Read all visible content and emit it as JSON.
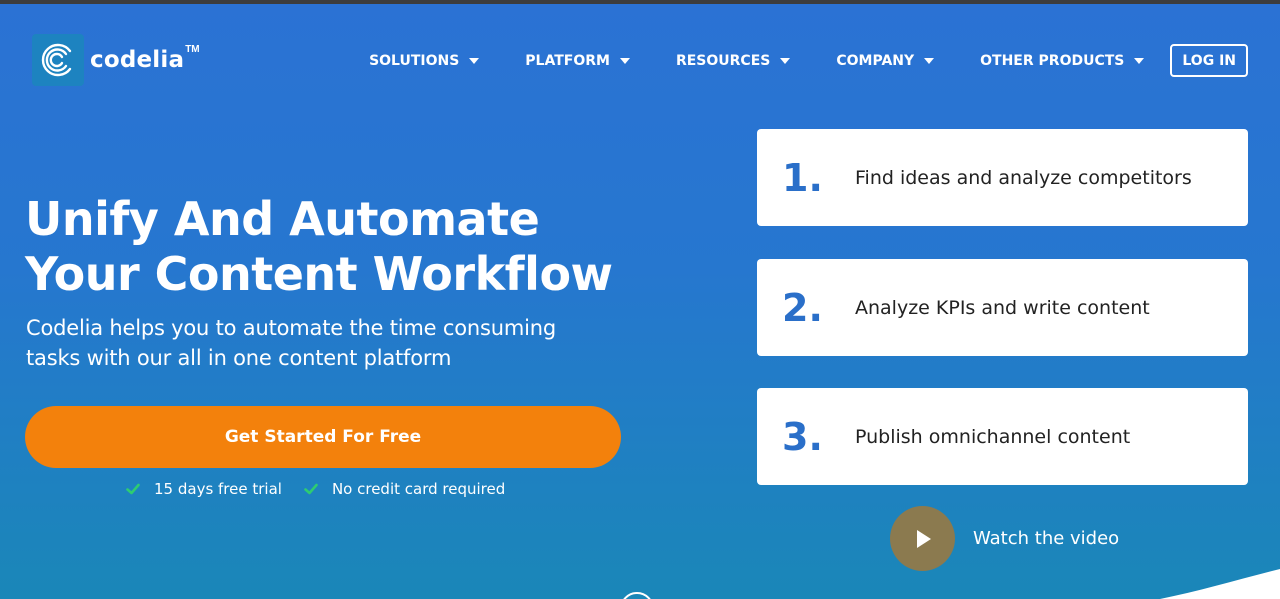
{
  "brand": {
    "name": "codelia",
    "trademark": "TM",
    "logo_icon": "concentric-c-logo-icon"
  },
  "nav": {
    "items": [
      {
        "label": "SOLUTIONS",
        "icon": "caret-down-icon"
      },
      {
        "label": "PLATFORM",
        "icon": "caret-down-icon"
      },
      {
        "label": "RESOURCES",
        "icon": "caret-down-icon"
      },
      {
        "label": "COMPANY",
        "icon": "caret-down-icon"
      },
      {
        "label": "OTHER PRODUCTS",
        "icon": "caret-down-icon"
      }
    ],
    "login_label": "LOG IN"
  },
  "hero": {
    "title_line1": "Unify And Automate",
    "title_line2": "Your Content Workflow",
    "subtitle_line1": "Codelia helps you to automate the time consuming",
    "subtitle_line2": "tasks with our all in one content platform",
    "cta_label": "Get Started For Free",
    "perks": [
      {
        "label": "15 days free trial",
        "icon": "check-icon"
      },
      {
        "label": "No credit card required",
        "icon": "check-icon"
      }
    ]
  },
  "steps": [
    {
      "number": "1.",
      "text": "Find ideas and analyze competitors"
    },
    {
      "number": "2.",
      "text": "Analyze KPIs and write content"
    },
    {
      "number": "3.",
      "text": "Publish omnichannel content"
    }
  ],
  "video": {
    "label": "Watch the video",
    "icon": "play-icon"
  },
  "colors": {
    "bg_top": "#2b72d4",
    "bg_bottom": "#1a87b8",
    "cta": "#f3810c",
    "step_number": "#2a6fc9",
    "check": "#2ecc71",
    "play_button": "#8b7a4f"
  }
}
